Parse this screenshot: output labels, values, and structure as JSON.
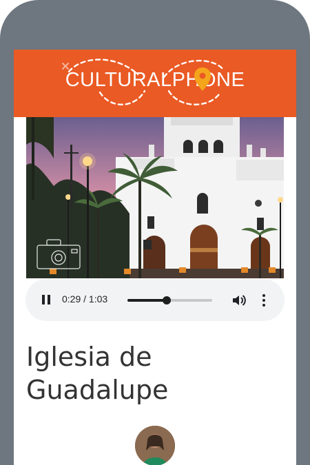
{
  "app": {
    "logo_text": "CULTURALPHONE"
  },
  "audio": {
    "state": "playing",
    "current_time": "0:29",
    "duration": "1:03",
    "time_display": "0:29 / 1:03",
    "progress": 0.46
  },
  "article": {
    "title": "Iglesia de Guadalupe"
  },
  "colors": {
    "brand": "#ea5a24",
    "frame": "#6e767f",
    "player_bg": "#f1f3f4"
  },
  "icons": [
    "pause-icon",
    "volume-icon",
    "more-vert-icon",
    "location-pin-icon",
    "camera-watermark-icon"
  ]
}
